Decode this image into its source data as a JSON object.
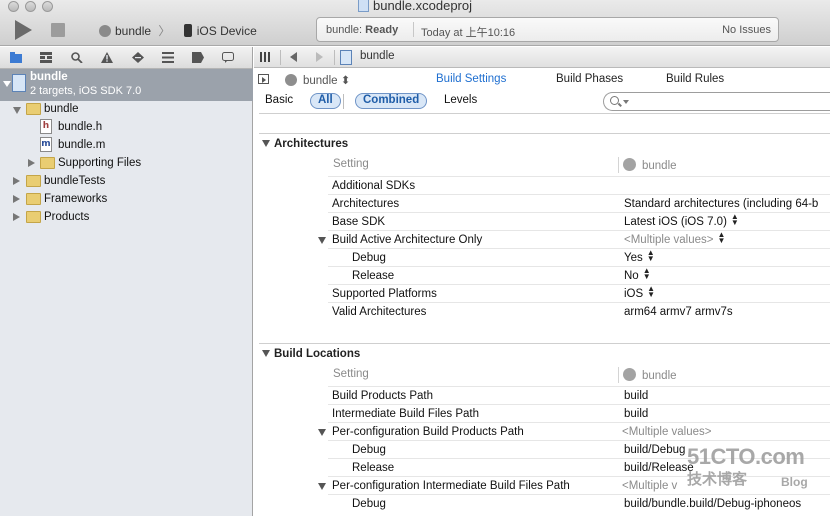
{
  "window": {
    "title": "bundle.xcodeproj"
  },
  "toolbar": {
    "scheme_target": "bundle",
    "scheme_separator": "〉",
    "scheme_device": "iOS Device"
  },
  "activity": {
    "project": "bundle",
    "status": "Ready",
    "time": "Today at 上午10:16",
    "issues": "No Issues"
  },
  "navigator": {
    "project_name": "bundle",
    "project_subtitle": "2 targets, iOS SDK 7.0",
    "tree": [
      {
        "label": "bundle",
        "kind": "folder",
        "state": "open"
      },
      {
        "label": "bundle.h",
        "kind": "header"
      },
      {
        "label": "bundle.m",
        "kind": "implementation"
      },
      {
        "label": "Supporting Files",
        "kind": "folder",
        "state": "closed"
      },
      {
        "label": "bundleTests",
        "kind": "folder",
        "state": "closed"
      },
      {
        "label": "Frameworks",
        "kind": "folder",
        "state": "closed"
      },
      {
        "label": "Products",
        "kind": "folder",
        "state": "closed"
      }
    ]
  },
  "editor": {
    "breadcrumb": "bundle",
    "target_selector": "bundle",
    "target_arrows": "⬍",
    "tabs": [
      "Build Settings",
      "Build Phases",
      "Build Rules"
    ],
    "filters": {
      "basic": "Basic",
      "all": "All",
      "combined": "Combined",
      "levels": "Levels"
    },
    "search": {
      "placeholder": "",
      "value": ""
    }
  },
  "sections": {
    "architectures": {
      "title": "Architectures",
      "col_setting": "Setting",
      "col_target": "bundle",
      "rows": [
        {
          "name": "Additional SDKs",
          "value": ""
        },
        {
          "name": "Architectures",
          "value": "Standard architectures (including 64-b"
        },
        {
          "name": "Base SDK",
          "value": "Latest iOS (iOS 7.0)"
        },
        {
          "name": "Build Active Architecture Only",
          "value": "<Multiple values>"
        },
        {
          "name": "Debug",
          "value": "Yes"
        },
        {
          "name": "Release",
          "value": "No"
        },
        {
          "name": "Supported Platforms",
          "value": "iOS"
        },
        {
          "name": "Valid Architectures",
          "value": "arm64 armv7 armv7s"
        }
      ]
    },
    "build_locations": {
      "title": "Build Locations",
      "col_setting": "Setting",
      "col_target": "bundle",
      "rows": [
        {
          "name": "Build Products Path",
          "value": "build"
        },
        {
          "name": "Intermediate Build Files Path",
          "value": "build"
        },
        {
          "name": "Per-configuration Build Products Path",
          "value": "<Multiple values>"
        },
        {
          "name": "Debug",
          "value": "build/Debug"
        },
        {
          "name": "Release",
          "value": "build/Release"
        },
        {
          "name": "Per-configuration Intermediate Build Files Path",
          "value": "<Multiple v"
        },
        {
          "name": "Debug",
          "value": "build/bundle.build/Debug-iphoneos"
        }
      ]
    }
  },
  "watermark": {
    "line1": "51CTO.com",
    "line2": "技术博客",
    "line3": "Blog"
  }
}
